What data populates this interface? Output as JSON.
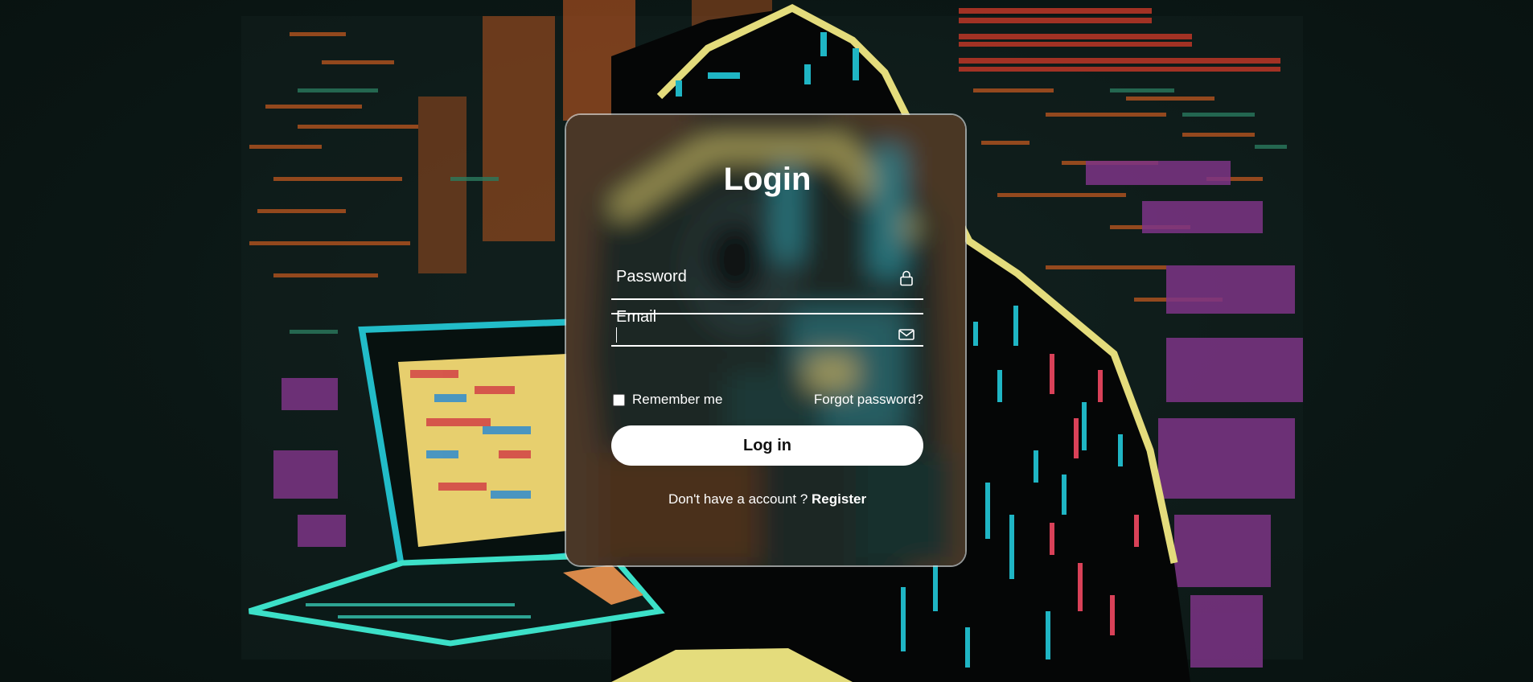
{
  "login_form": {
    "title": "Login",
    "email_label": "Email",
    "email_icon": "envelope-icon",
    "password_label": "Password",
    "password_icon": "lock-icon",
    "remember_label": "Remember me",
    "remember_checked": false,
    "forgot_label": "Forgot password?",
    "login_button_label": "Log in",
    "register_prompt": "Don't have a account ? ",
    "register_label": "Register"
  },
  "colors": {
    "text": "#ffffff",
    "button_bg": "#ffffff",
    "button_text": "#111111",
    "card_border": "#d9d9d9"
  }
}
